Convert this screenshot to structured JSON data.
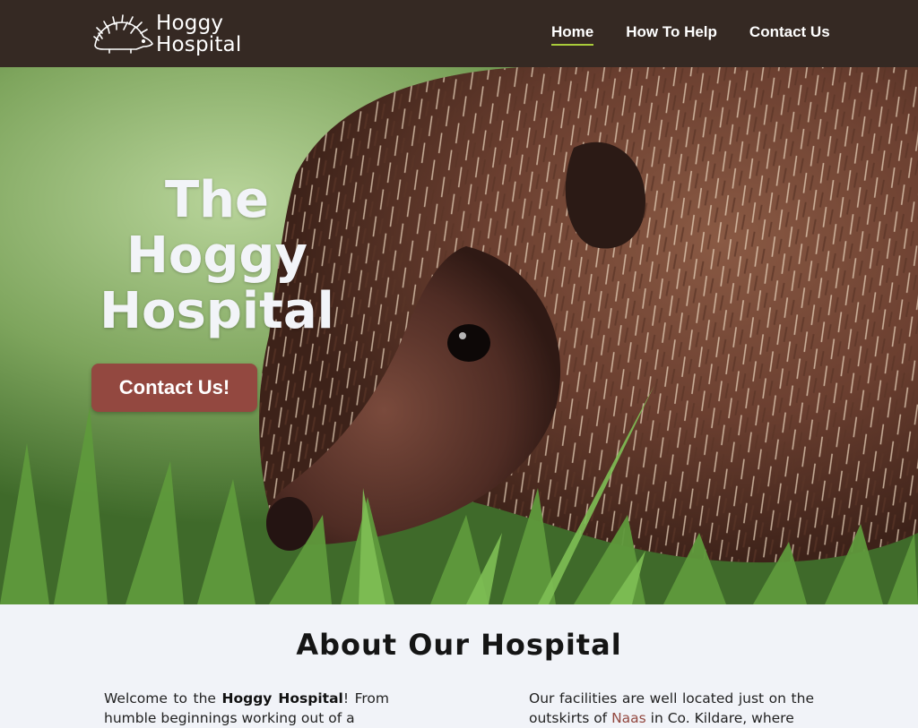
{
  "header": {
    "brand_line1": "Hoggy",
    "brand_line2": "Hospital",
    "logo_icon": "hedgehog-logo-icon",
    "nav": [
      {
        "label": "Home",
        "active": true
      },
      {
        "label": "How To Help",
        "active": false
      },
      {
        "label": "Contact Us",
        "active": false
      }
    ]
  },
  "hero": {
    "title_line1": "The",
    "title_line2": "Hoggy",
    "title_line3": "Hospital",
    "cta_label": "Contact Us!",
    "image": "hedgehog-photo"
  },
  "about": {
    "title": "About Our Hospital",
    "left_pre": "Welcome to the ",
    "left_bold": "Hoggy Hospital",
    "left_post": "! From humble beginnings working out of a",
    "right_pre": "Our facilities are well located just on the outskirts of ",
    "right_link": "Naas",
    "right_post": " in Co. Kildare, where"
  },
  "colors": {
    "navbar_bg": "#352923",
    "accent_underline": "#a9cc3a",
    "cta_bg": "#934840",
    "page_bg": "#f1f3f8"
  }
}
